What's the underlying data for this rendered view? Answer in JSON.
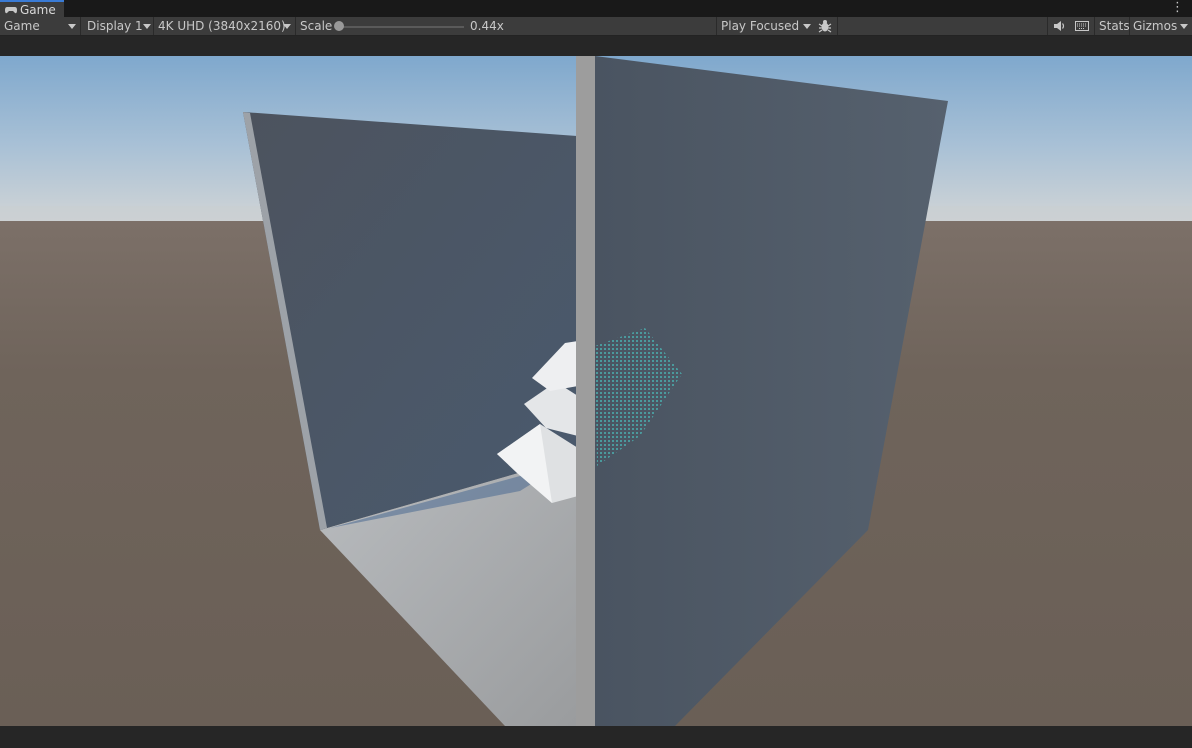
{
  "tab": {
    "title": "Game",
    "icon": "gamepad-icon"
  },
  "toolbar": {
    "mode": "Game",
    "display": "Display 1",
    "resolution": "4K UHD (3840x2160)",
    "scale_label": "Scale",
    "scale_value": "0.44x",
    "scale_fraction": 0.0,
    "play_mode": "Play Focused",
    "stats": "Stats",
    "gizmos": "Gizmos",
    "icons": [
      "bug-icon",
      "speaker-icon",
      "keyboard-icon",
      "more-vertical-icon"
    ]
  },
  "colors": {
    "panel": "#3c3c3c",
    "sky_top": "#87aed0",
    "horizon": "#c8cfd4",
    "ground": "#6e6258",
    "panel_wall": "#4e5966",
    "accent_tab": "#3a7bd5"
  }
}
